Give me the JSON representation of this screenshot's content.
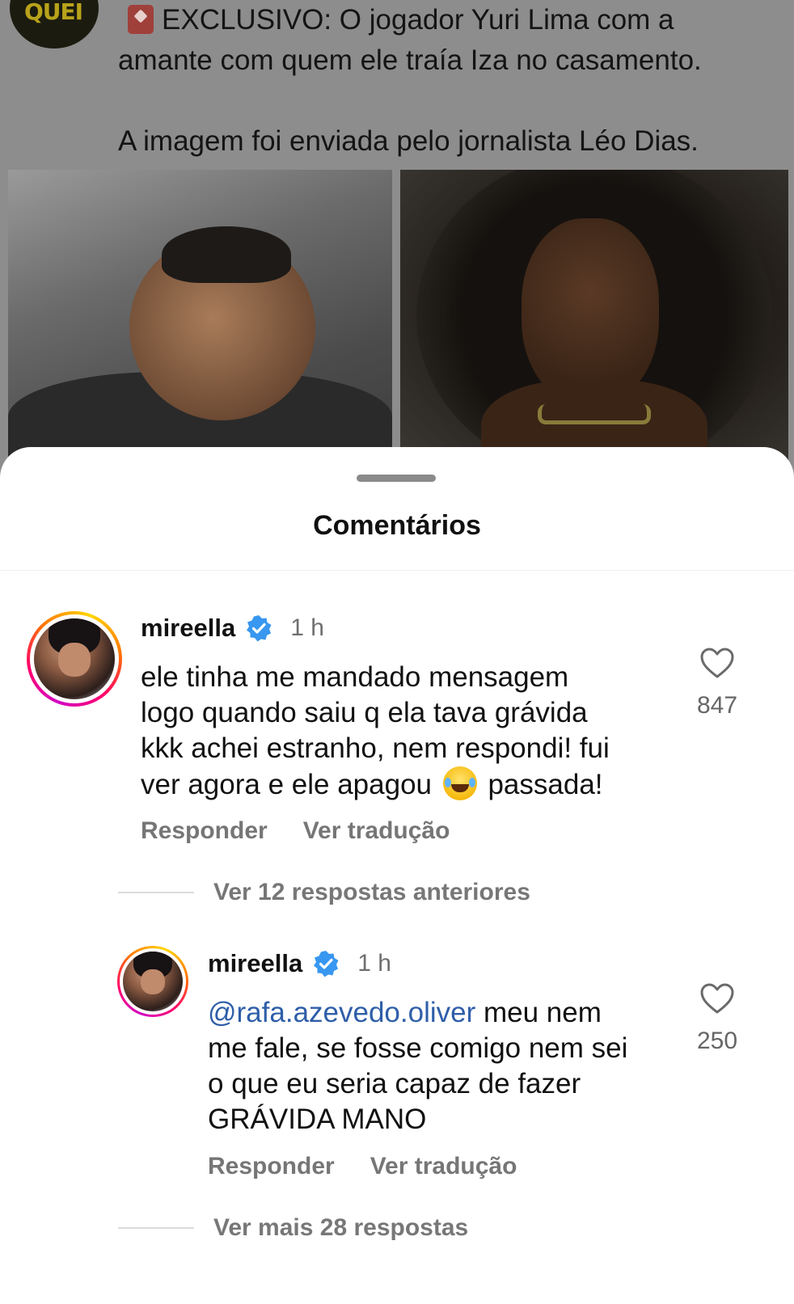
{
  "post": {
    "avatar_text": "QUEI",
    "line1": "EXCLUSIVO: O jogador Yuri Lima com a",
    "line2": "amante com quem ele traía Iza no casamento.",
    "line3": "A imagem foi enviada pelo jornalista Léo Dias."
  },
  "sheet": {
    "title": "Comentários"
  },
  "comments": [
    {
      "username": "mireella",
      "time": "1 h",
      "lines": [
        "ele tinha me mandado mensagem",
        "logo quando saiu q ela tava grávida",
        "kkk achei estranho, nem respondi! fui"
      ],
      "line4_before_emoji": "ver agora e ele apagou",
      "line4_after_emoji": "passada!",
      "emoji": "tears-of-joy",
      "likes": "847",
      "reply_label": "Responder",
      "translate_label": "Ver tradução"
    }
  ],
  "previous_replies": "Ver 12 respostas anteriores",
  "reply": {
    "username": "mireella",
    "time": "1 h",
    "mention": "@rafa.azevedo.oliver",
    "line1_rest": " meu nem",
    "lines": [
      "me fale, se fosse comigo nem sei",
      "o que eu seria capaz de fazer",
      "GRÁVIDA MANO"
    ],
    "likes": "250",
    "reply_label": "Responder",
    "translate_label": "Ver tradução"
  },
  "more_replies": "Ver mais 28 respostas",
  "colors": {
    "verified": "#3897f0",
    "mention": "#2e5ea8"
  }
}
